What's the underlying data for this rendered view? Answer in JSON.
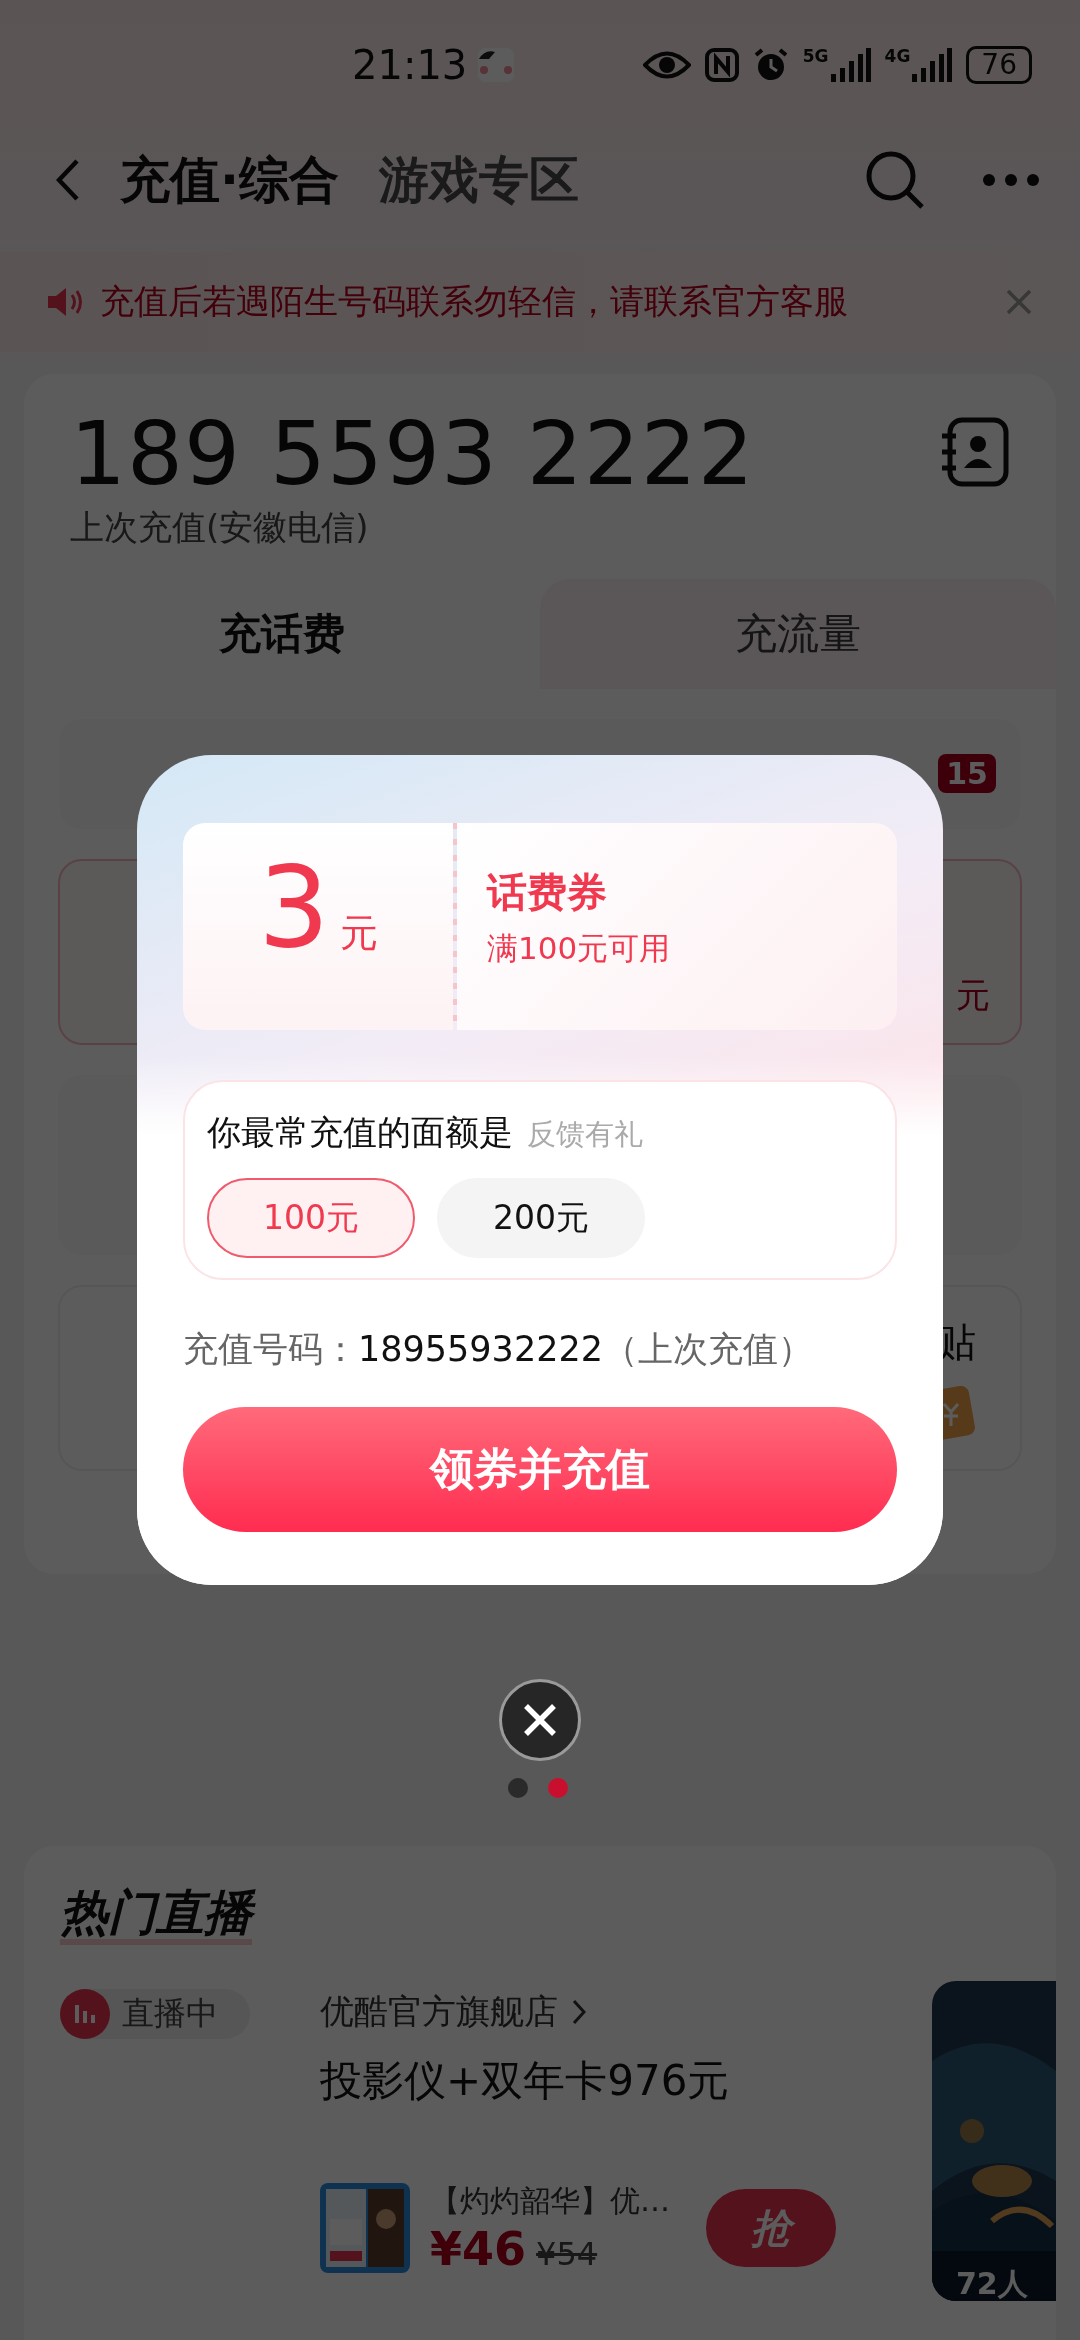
{
  "status_bar": {
    "time": "21:13",
    "network_1": "5G",
    "network_2": "4G",
    "battery": "76"
  },
  "header": {
    "tabs": [
      {
        "label": "充值·综合",
        "selected": true
      },
      {
        "label": "游戏专区",
        "selected": false
      }
    ]
  },
  "notice": {
    "text": "充值后若遇陌生号码联系勿轻信，请联系官方客服"
  },
  "account": {
    "phone": "189 5593 2222",
    "note": "上次充值(安徽电信)"
  },
  "recharge_tabs": [
    {
      "label": "充话费",
      "selected": true
    },
    {
      "label": "充流量",
      "selected": false
    }
  ],
  "background_fragments": {
    "badge": "15",
    "price_unit": "元",
    "subsidy_text": "贴"
  },
  "dialog": {
    "coupon": {
      "amount": "3",
      "unit": "元",
      "title": "话费券",
      "condition": "满100元可用"
    },
    "question": "你最常充值的面额是",
    "question_hint": "反馈有礼",
    "options": [
      {
        "label": "100元",
        "selected": true
      },
      {
        "label": "200元",
        "selected": false
      }
    ],
    "phone_label": "充值号码：",
    "phone": "18955932222",
    "phone_note": "（上次充值）",
    "button": "领券并充值"
  },
  "pager": [
    {
      "selected": false
    },
    {
      "selected": true
    }
  ],
  "hot_live": {
    "title": "热门直播",
    "badge": "直播中",
    "shop": "优酷官方旗舰店",
    "headline": "投影仪+双年卡976元",
    "product": {
      "name": "【灼灼韶华】优…",
      "price": "¥46",
      "original_price": "¥54",
      "button": "抢"
    },
    "viewers": "72人"
  }
}
